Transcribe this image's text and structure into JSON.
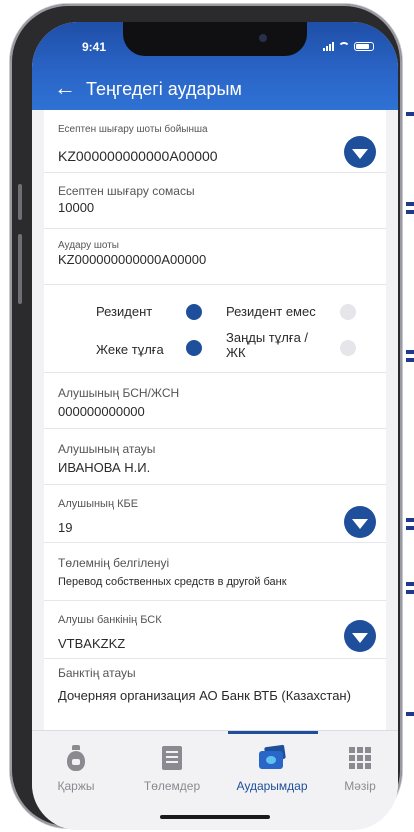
{
  "status_bar": {
    "time": "9:41"
  },
  "header": {
    "title": "Теңгедегі аударым"
  },
  "form": {
    "debit_account": {
      "label": "Есептен шығару шоты бойынша",
      "value": "KZ000000000000A00000"
    },
    "amount": {
      "label": "Есептен шығару сомасы",
      "value": "10000"
    },
    "transfer_account": {
      "label": "Аудару шоты",
      "value": "KZ000000000000A00000"
    },
    "residency": {
      "option_resident": "Резидент",
      "option_non_resident": "Резидент емес",
      "selected": "Резидент"
    },
    "person_type": {
      "option_individual": "Жеке тұлға",
      "option_legal": "Заңды тұлға /\nЖК",
      "selected": "Жеке тұлға"
    },
    "recipient_bin": {
      "label": "Алушының БСН/ЖСН",
      "value": "000000000000"
    },
    "recipient_name": {
      "label": "Алушының атауы",
      "value": "ИВАНОВА Н.И."
    },
    "recipient_kbe": {
      "label": "Алушының КБЕ",
      "value": "19"
    },
    "payment_purpose": {
      "label": "Төлемнің белгіленуі",
      "value": "Перевод собственных средств в другой банк"
    },
    "recipient_bank_bic": {
      "label": "Алушы банкінің БСК",
      "value": "VTBAKZKZ"
    },
    "bank_name": {
      "label": "Банктің атауы",
      "value": "Дочерняя организация АО Банк ВТБ (Казахстан)"
    }
  },
  "tabbar": {
    "tabs": [
      {
        "label": "Қаржы",
        "icon": "money-bag-icon"
      },
      {
        "label": "Төлемдер",
        "icon": "payments-list-icon"
      },
      {
        "label": "Аударымдар",
        "icon": "transfer-card-icon",
        "active": true
      },
      {
        "label": "Мәзір",
        "icon": "menu-grid-icon"
      }
    ]
  },
  "colors": {
    "accent": "#1f4f9a",
    "header": "#2a66c8",
    "inactive_tab": "#8a8a90"
  }
}
